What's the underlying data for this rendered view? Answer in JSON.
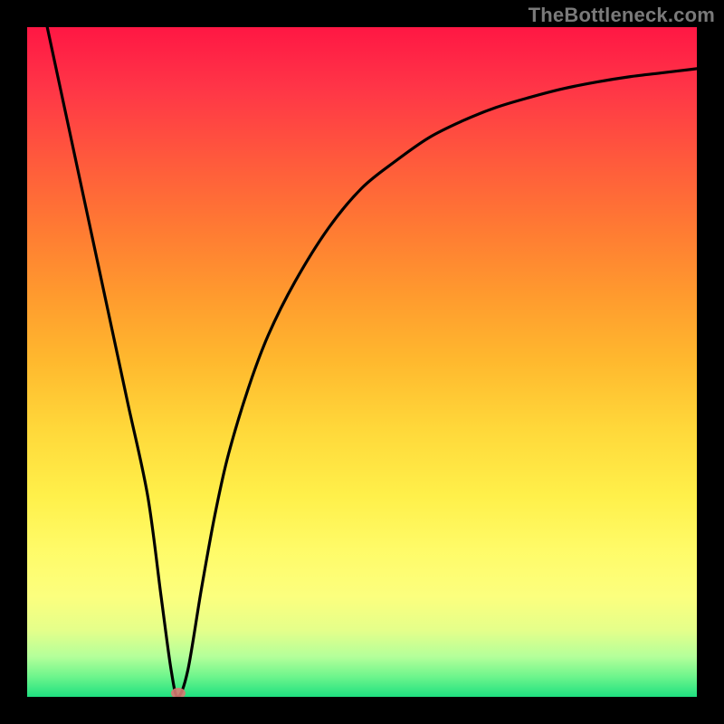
{
  "watermark": "TheBottleneck.com",
  "colors": {
    "background": "#000000",
    "gradient_top": "#ff1744",
    "gradient_mid": "#ffd83a",
    "gradient_bottom": "#1fe080",
    "curve": "#000000",
    "marker": "#d87a72"
  },
  "chart_data": {
    "type": "line",
    "title": "",
    "xlabel": "",
    "ylabel": "",
    "xlim": [
      0,
      100
    ],
    "ylim": [
      0,
      100
    ],
    "grid": false,
    "legend": false,
    "series": [
      {
        "name": "curve",
        "x": [
          3,
          6,
          9,
          12,
          15,
          18,
          20,
          21.5,
          22.5,
          24,
          26,
          28,
          30,
          33,
          36,
          40,
          45,
          50,
          55,
          60,
          65,
          70,
          75,
          80,
          85,
          90,
          95,
          100
        ],
        "y": [
          100,
          86,
          72,
          58,
          44,
          30,
          15,
          4,
          0,
          4,
          16,
          27,
          36,
          46,
          54,
          62,
          70,
          76,
          80,
          83.5,
          86,
          88,
          89.5,
          90.8,
          91.8,
          92.6,
          93.2,
          93.8
        ]
      }
    ],
    "marker": {
      "x": 22.5,
      "y": 0
    },
    "notes": "V-shaped bottleneck curve over red-to-green vertical heat gradient. Values estimated from pixel positions; axes have no labels or ticks."
  }
}
